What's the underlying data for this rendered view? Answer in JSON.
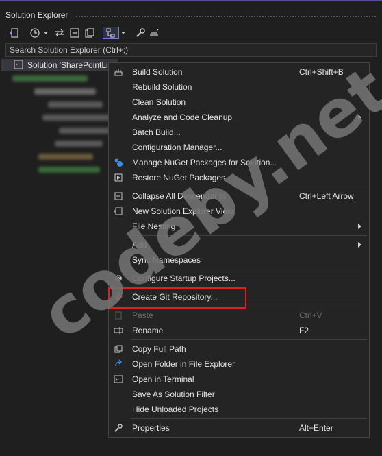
{
  "window": {
    "title": "Solution Explorer"
  },
  "search": {
    "placeholder": "Search Solution Explorer (Ctrl+;)"
  },
  "tree": {
    "solution_label": "Solution 'SharePointLi"
  },
  "toolbar": {
    "icons": [
      "switch-views-icon",
      "pending-changes-filter-icon",
      "dropdown-icon",
      "sync-icon",
      "collapse-all-icon",
      "show-all-files-icon",
      "properties-filter-icon",
      "dropdown-icon",
      "wrench-icon",
      "preview-icon"
    ]
  },
  "context_menu": {
    "items": [
      {
        "label": "Build Solution",
        "shortcut": "Ctrl+Shift+B",
        "icon": "build-icon"
      },
      {
        "label": "Rebuild Solution",
        "shortcut": ""
      },
      {
        "label": "Clean Solution",
        "shortcut": ""
      },
      {
        "label": "Analyze and Code Cleanup",
        "shortcut": "",
        "submenu": true
      },
      {
        "label": "Batch Build...",
        "shortcut": ""
      },
      {
        "label": "Configuration Manager...",
        "shortcut": ""
      },
      {
        "label": "Manage NuGet Packages for Solution...",
        "shortcut": "",
        "icon": "nuget-icon"
      },
      {
        "label": "Restore NuGet Packages",
        "shortcut": "",
        "icon": "restore-icon"
      },
      {
        "label": "Collapse All Descendants",
        "shortcut": "Ctrl+Left Arrow",
        "icon": "collapse-icon"
      },
      {
        "label": "New Solution Explorer View",
        "shortcut": "",
        "icon": "new-view-icon"
      },
      {
        "label": "File Nesting",
        "shortcut": "",
        "submenu": true
      },
      {
        "label": "Add",
        "shortcut": "",
        "submenu": true
      },
      {
        "label": "Sync Namespaces",
        "shortcut": ""
      },
      {
        "label": "Configure Startup Projects...",
        "shortcut": "",
        "icon": "gear-icon"
      },
      {
        "label": "Create Git Repository...",
        "shortcut": "",
        "icon": "git-icon"
      },
      {
        "label": "Paste",
        "shortcut": "Ctrl+V",
        "disabled": true,
        "icon": "paste-icon"
      },
      {
        "label": "Rename",
        "shortcut": "F2",
        "icon": "rename-icon"
      },
      {
        "label": "Copy Full Path",
        "shortcut": "",
        "icon": "copy-icon"
      },
      {
        "label": "Open Folder in File Explorer",
        "shortcut": "",
        "icon": "open-folder-icon"
      },
      {
        "label": "Open in Terminal",
        "shortcut": "",
        "icon": "terminal-icon"
      },
      {
        "label": "Save As Solution Filter",
        "shortcut": ""
      },
      {
        "label": "Hide Unloaded Projects",
        "shortcut": ""
      },
      {
        "label": "Properties",
        "shortcut": "Alt+Enter",
        "icon": "wrench-icon"
      }
    ]
  },
  "watermark": {
    "text": "codeby.net"
  },
  "colors": {
    "background": "#1f1f1f",
    "menu_background": "#242424",
    "title_accent": "#5a4f9a",
    "highlight_border": "#e02020",
    "vs_purple": "#b180d7"
  }
}
